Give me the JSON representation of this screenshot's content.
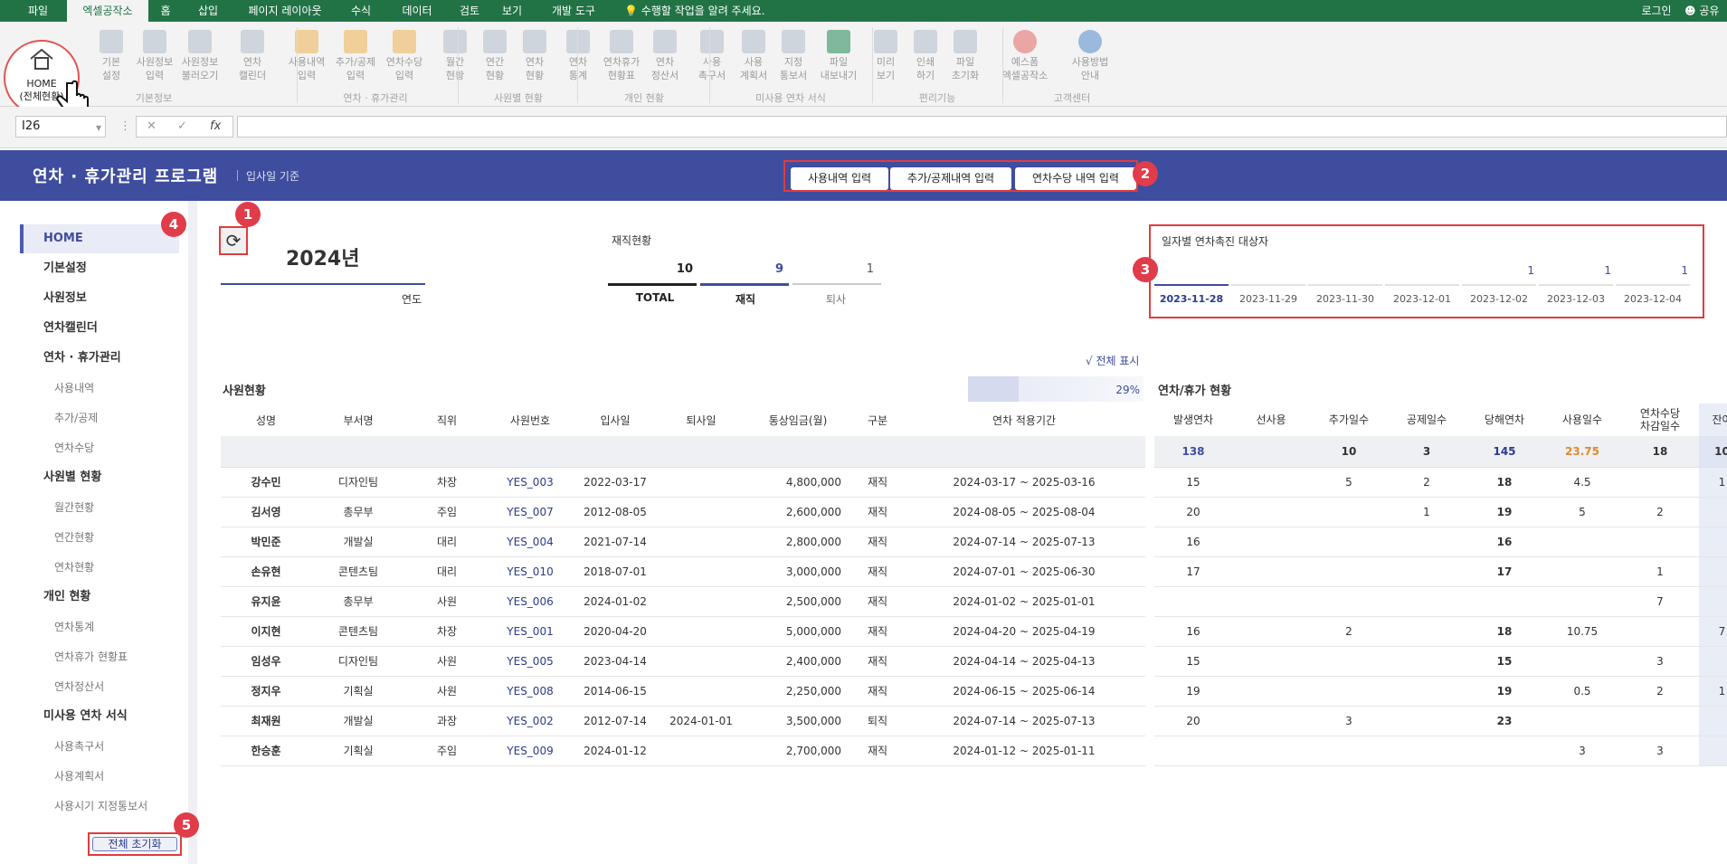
{
  "ribbon_tabs": [
    "파일",
    "엑셀공작소",
    "홈",
    "삽입",
    "페이지 레이아웃",
    "수식",
    "데이터",
    "검토",
    "보기",
    "개발 도구"
  ],
  "tell_me": "수행할 작업을 알려 주세요.",
  "login": "로그인",
  "share": "공유",
  "ribbon": {
    "home": "HOME\n(전체현황)",
    "buttons": [
      "기본\n설정",
      "사원정보\n입력",
      "사원정보\n불러오기",
      "연차\n캘린더",
      "사용내역\n입력",
      "추가/공제\n입력",
      "연차수당\n입력",
      "월간\n현황",
      "연간\n현황",
      "연차\n현황",
      "연차\n통계",
      "연차휴가\n현황표",
      "연차\n정산서",
      "사용\n촉구서",
      "사용\n계획서",
      "지정\n통보서",
      "파일\n내보내기",
      "미리\n보기",
      "인쇄\n하기",
      "파일\n초기화",
      "예스폼\n엑셀공작소",
      "사용방법\n안내"
    ],
    "groups": [
      "기본정보",
      "연차 · 휴가관리",
      "사원별 현황",
      "개인 현황",
      "미사용 연차 서식",
      "편리기능",
      "고객센터"
    ]
  },
  "formula_bar": {
    "cell_ref": "I26",
    "fx": "fx",
    "cancel": "✕",
    "enter": "✓"
  },
  "banner": {
    "title": "연차 · 휴가관리 프로그램",
    "subtitle": "입사일 기준",
    "buttons": [
      "사용내역 입력",
      "추가/공제내역 입력",
      "연차수당 내역 입력"
    ]
  },
  "badges": [
    "1",
    "2",
    "3",
    "4",
    "5"
  ],
  "sidebar": {
    "items": [
      {
        "label": "HOME",
        "kind": "active"
      },
      {
        "label": "기본설정",
        "kind": "main"
      },
      {
        "label": "사원정보",
        "kind": "main"
      },
      {
        "label": "연차캘린더",
        "kind": "main"
      },
      {
        "label": "연차 · 휴가관리",
        "kind": "main"
      },
      {
        "label": "사용내역",
        "kind": "sub"
      },
      {
        "label": "추가/공제",
        "kind": "sub"
      },
      {
        "label": "연차수당",
        "kind": "sub"
      },
      {
        "label": "사원별 현황",
        "kind": "main"
      },
      {
        "label": "월간현황",
        "kind": "sub"
      },
      {
        "label": "연간현황",
        "kind": "sub"
      },
      {
        "label": "연차현황",
        "kind": "sub"
      },
      {
        "label": "개인 현황",
        "kind": "main"
      },
      {
        "label": "연차통계",
        "kind": "sub"
      },
      {
        "label": "연차휴가 현황표",
        "kind": "sub"
      },
      {
        "label": "연차정산서",
        "kind": "sub"
      },
      {
        "label": "미사용 연차 서식",
        "kind": "main"
      },
      {
        "label": "사용촉구서",
        "kind": "sub"
      },
      {
        "label": "사용계획서",
        "kind": "sub"
      },
      {
        "label": "사용시기 지정통보서",
        "kind": "sub"
      }
    ],
    "reset_button": "전체 초기화"
  },
  "summary": {
    "year": "2024년",
    "year_label": "연도",
    "employment_title": "재직현황",
    "total": "10",
    "total_label": "TOTAL",
    "active": "9",
    "active_label": "재직",
    "resigned": "1",
    "resigned_label": "퇴사"
  },
  "promo_dates": {
    "title": "일자별 연차촉진 대상자",
    "dates": [
      "2023-11-28",
      "2023-11-29",
      "2023-11-30",
      "2023-12-01",
      "2023-12-02",
      "2023-12-03",
      "2023-12-04"
    ],
    "counts": [
      "",
      "",
      "",
      "",
      "1",
      "1",
      "1"
    ]
  },
  "show_all": "√ 전체 표시",
  "progress": {
    "percent": 29,
    "label": "29%"
  },
  "employee_section": "사원현황",
  "leave_section": "연차/휴가 현황",
  "emp_headers": [
    "성명",
    "부서명",
    "직위",
    "사원번호",
    "입사일",
    "퇴사일",
    "통상임금(월)",
    "구분",
    "연차 적용기간"
  ],
  "leave_headers": [
    "발생연차",
    "선사용",
    "추가일수",
    "공제일수",
    "당해연차",
    "사용일수",
    "연차수당\n차감일수",
    "잔여"
  ],
  "leave_totals": [
    "138",
    "",
    "10",
    "3",
    "145",
    "23.75",
    "18",
    "10"
  ],
  "rows": [
    {
      "emp": [
        "강수민",
        "디자인팀",
        "차장",
        "YES_003",
        "2022-03-17",
        "",
        "4,800,000",
        "재직",
        "2024-03-17 ~ 2025-03-16"
      ],
      "leave": [
        "15",
        "",
        "5",
        "2",
        "18",
        "4.5",
        "",
        "1"
      ]
    },
    {
      "emp": [
        "김서영",
        "총무부",
        "주임",
        "YES_007",
        "2012-08-05",
        "",
        "2,600,000",
        "재직",
        "2024-08-05 ~ 2025-08-04"
      ],
      "leave": [
        "20",
        "",
        "",
        "1",
        "19",
        "5",
        "2",
        ""
      ]
    },
    {
      "emp": [
        "박민준",
        "개발실",
        "대리",
        "YES_004",
        "2021-07-14",
        "",
        "2,800,000",
        "재직",
        "2024-07-14 ~ 2025-07-13"
      ],
      "leave": [
        "16",
        "",
        "",
        "",
        "16",
        "",
        "",
        ""
      ]
    },
    {
      "emp": [
        "손유현",
        "콘텐츠팀",
        "대리",
        "YES_010",
        "2018-07-01",
        "",
        "3,000,000",
        "재직",
        "2024-07-01 ~ 2025-06-30"
      ],
      "leave": [
        "17",
        "",
        "",
        "",
        "17",
        "",
        "1",
        ""
      ]
    },
    {
      "emp": [
        "유지윤",
        "총무부",
        "사원",
        "YES_006",
        "2024-01-02",
        "",
        "2,500,000",
        "재직",
        "2024-01-02 ~ 2025-01-01"
      ],
      "leave": [
        "",
        "",
        "",
        "",
        "",
        "",
        "7",
        ""
      ]
    },
    {
      "emp": [
        "이지현",
        "콘텐츠팀",
        "차장",
        "YES_001",
        "2020-04-20",
        "",
        "5,000,000",
        "재직",
        "2024-04-20 ~ 2025-04-19"
      ],
      "leave": [
        "16",
        "",
        "2",
        "",
        "18",
        "10.75",
        "",
        "7"
      ]
    },
    {
      "emp": [
        "임성우",
        "디자인팀",
        "사원",
        "YES_005",
        "2023-04-14",
        "",
        "2,400,000",
        "재직",
        "2024-04-14 ~ 2025-04-13"
      ],
      "leave": [
        "15",
        "",
        "",
        "",
        "15",
        "",
        "3",
        ""
      ]
    },
    {
      "emp": [
        "정지우",
        "기획실",
        "사원",
        "YES_008",
        "2014-06-15",
        "",
        "2,250,000",
        "재직",
        "2024-06-15 ~ 2025-06-14"
      ],
      "leave": [
        "19",
        "",
        "",
        "",
        "19",
        "0.5",
        "2",
        "1"
      ]
    },
    {
      "emp": [
        "최재원",
        "개발실",
        "과장",
        "YES_002",
        "2012-07-14",
        "2024-01-01",
        "3,500,000",
        "퇴직",
        "2024-07-14 ~ 2025-07-13"
      ],
      "leave": [
        "20",
        "",
        "3",
        "",
        "23",
        "",
        "",
        ""
      ]
    },
    {
      "emp": [
        "한승훈",
        "기획실",
        "주임",
        "YES_009",
        "2024-01-12",
        "",
        "2,700,000",
        "재직",
        "2024-01-12 ~ 2025-01-11"
      ],
      "leave": [
        "",
        "",
        "",
        "",
        "",
        "3",
        "3",
        ""
      ]
    }
  ]
}
